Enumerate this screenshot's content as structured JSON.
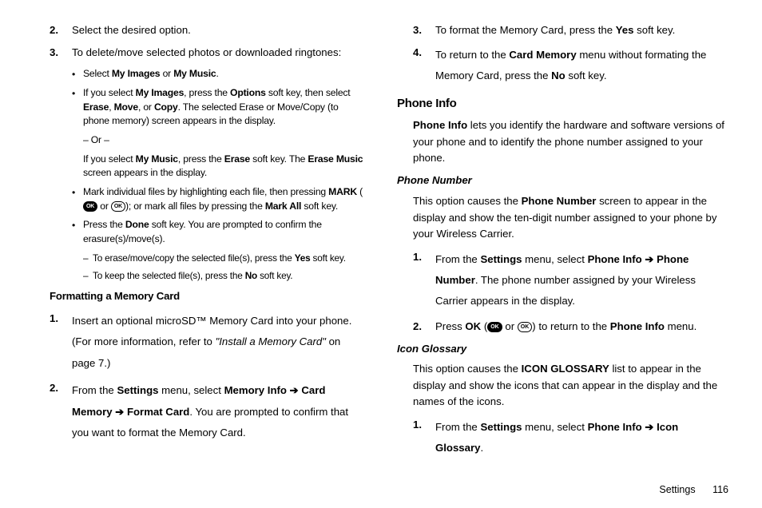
{
  "left": {
    "step2": {
      "num": "2.",
      "text": "Select the desired option."
    },
    "step3": {
      "num": "3.",
      "text": "To delete/move selected photos or downloaded ringtones:"
    },
    "b1": {
      "pre": "Select ",
      "my_images": "My Images",
      "or": " or ",
      "my_music": "My Music",
      "post": "."
    },
    "b2": {
      "if": "If you select ",
      "my_images": "My Images",
      "press": ", press the ",
      "options": "Options",
      "then": " soft key, then select ",
      "erase": "Erase",
      "c1": ", ",
      "move": "Move",
      "c2": ", or ",
      "copy": "Copy",
      "rest": ". The selected Erase or Move/Copy (to phone memory) screen appears in the display."
    },
    "or": "– Or –",
    "b2b": {
      "if": "If you select ",
      "my_music": "My Music",
      "press": ", press the ",
      "erase": "Erase",
      "rest1": " soft key. The ",
      "erase_music": "Erase Music",
      "rest2": " screen appears in the display."
    },
    "b3": {
      "t1": "Mark individual files by highlighting each file, then pressing ",
      "mark": "MARK",
      "paren_open": " (",
      "ok": " or ",
      "paren_close": "); or mark all files by pressing the ",
      "mark_all": "Mark All",
      "t2": " soft key."
    },
    "b4": {
      "t1": "Press the ",
      "done": "Done",
      "t2": " soft key. You are prompted to confirm the erasure(s)/move(s)."
    },
    "d1": {
      "t1": "To erase/move/copy the selected file(s), press the ",
      "yes": "Yes",
      "t2": " soft key."
    },
    "d2": {
      "t1": "To keep the selected file(s), press the ",
      "no": "No",
      "t2": " soft key."
    },
    "h_format": "Formatting a Memory Card",
    "f1": {
      "num": "1.",
      "t1": "Insert an optional microSD™ Memory Card into your phone. (For more information, refer to ",
      "ref": "\"Install a Memory Card\"",
      "t2": "  on page 7.)"
    },
    "f2": {
      "num": "2.",
      "t1": "From the ",
      "settings": "Settings",
      "t2": " menu, select ",
      "path": "Memory Info ➔ Card Memory ➔ Format Card",
      "t3": ". You are prompted to confirm that you want to format the Memory Card."
    }
  },
  "right": {
    "s3": {
      "num": "3.",
      "t1": "To format the Memory Card, press the ",
      "yes": "Yes",
      "t2": " soft key."
    },
    "s4": {
      "num": "4.",
      "t1": "To return to the ",
      "cm": "Card Memory",
      "t2": " menu without formating the Memory Card, press the ",
      "no": "No",
      "t3": " soft key."
    },
    "h_phone_info": "Phone Info",
    "pi_para": {
      "b": "Phone Info",
      "t": " lets you identify the hardware and software versions of your phone and to identify the phone number assigned to your phone."
    },
    "h_phone_number": "Phone Number",
    "pn_para": {
      "t1": "This option causes the ",
      "pn": "Phone Number",
      "t2": " screen to appear in the display and show the ten-digit number assigned to your phone by your Wireless Carrier."
    },
    "pn1": {
      "num": "1.",
      "t1": "From the ",
      "settings": "Settings",
      "t2": " menu, select ",
      "path": "Phone Info ➔ Phone Number",
      "t3": ". The phone number assigned by your Wireless Carrier appears in the display."
    },
    "pn2": {
      "num": "2.",
      "t1": "Press ",
      "ok": "OK",
      "paren": " (",
      "or": " or ",
      "close": ") to return to the ",
      "pi": "Phone Info",
      "t2": " menu."
    },
    "h_icon": "Icon Glossary",
    "ig_para": {
      "t1": "This option causes the ",
      "ig": "ICON GLOSSARY",
      "t2": " list to appear in the display and show the icons that can appear in the display and the names of the icons."
    },
    "ig1": {
      "num": "1.",
      "t1": "From the ",
      "settings": "Settings",
      "t2": " menu, select ",
      "path": "Phone Info ➔ Icon Glossary",
      "t3": "."
    }
  },
  "footer": {
    "section": "Settings",
    "page": "116"
  }
}
